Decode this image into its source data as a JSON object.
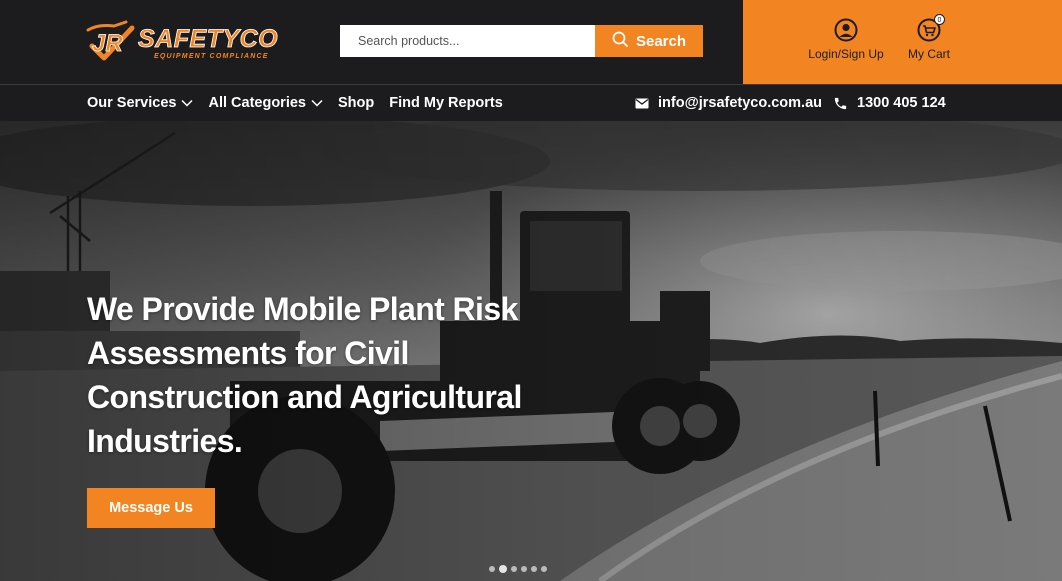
{
  "brand": {
    "logo_main": "JR SAFETYCO",
    "logo_sub": "EQUIPMENT COMPLIANCE",
    "accent_color": "#f28522",
    "dark_color": "#1c1c1e"
  },
  "header": {
    "search_placeholder": "Search products...",
    "search_button_label": "Search",
    "search_icon": "search-icon",
    "login_label": "Login/Sign Up",
    "login_icon": "user-circle-icon",
    "cart_label": "My Cart",
    "cart_icon": "cart-icon",
    "cart_count": "0"
  },
  "nav": {
    "items": [
      {
        "label": "Our Services",
        "has_dropdown": true
      },
      {
        "label": "All Categories",
        "has_dropdown": true
      },
      {
        "label": "Shop",
        "has_dropdown": false
      },
      {
        "label": "Find My Reports",
        "has_dropdown": false
      }
    ],
    "email": "info@jrsafetyco.com.au",
    "phone": "1300 405 124"
  },
  "hero": {
    "title": "We Provide Mobile Plant Risk Assessments for Civil Construction and Agricultural Industries.",
    "cta_label": "Message Us",
    "slide_count": 6,
    "active_slide": 2
  }
}
